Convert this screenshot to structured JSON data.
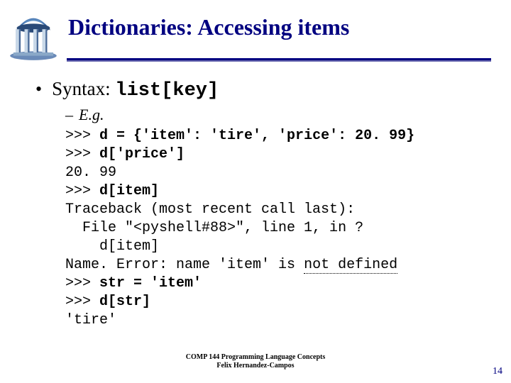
{
  "title": "Dictionaries: Accessing items",
  "bullet": "•",
  "syntax_label": "Syntax: ",
  "syntax_code": "list[key]",
  "dash": "–",
  "eg_label": "E.g.",
  "code": {
    "l1a": ">>> ",
    "l1b": "d = {'item': 'tire', 'price': 20. 99}",
    "l2a": ">>> ",
    "l2b": "d['price']",
    "l3": "20. 99",
    "l4a": ">>> ",
    "l4b": "d[item]",
    "l5": "Traceback (most recent call last):",
    "l6": "  File \"<pyshell#88>\", line 1, in ?",
    "l7": "    d[item]",
    "l8a": "Name. Error: name 'item' is ",
    "l8b": "not defined",
    "l9a": ">>> ",
    "l9b": "str = 'item'",
    "l10a": ">>> ",
    "l10b": "d[str]",
    "l11": "'tire'"
  },
  "footer1": "COMP 144 Programming Language Concepts",
  "footer2": "Felix Hernandez-Campos",
  "page_number": "14"
}
